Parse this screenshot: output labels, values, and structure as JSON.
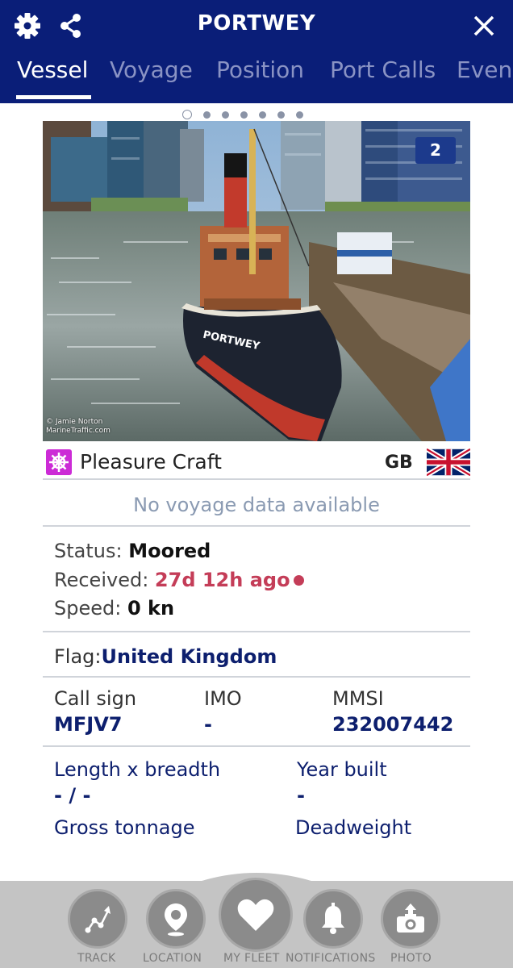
{
  "header": {
    "title": "PORTWEY",
    "tabs": [
      {
        "label": "Vessel",
        "active": true
      },
      {
        "label": "Voyage",
        "active": false
      },
      {
        "label": "Position",
        "active": false
      },
      {
        "label": "Port Calls",
        "active": false
      },
      {
        "label": "Even",
        "active": false
      }
    ]
  },
  "carousel": {
    "dot_count": 7,
    "active_index": 0
  },
  "photo": {
    "count_badge": "2",
    "credit_line1": "© Jamie Norton",
    "credit_line2": "MarineTraffic.com",
    "hull_name": "PORTWEY"
  },
  "vessel_type": {
    "label": "Pleasure Craft",
    "icon": "ship-wheel-icon",
    "icon_color": "#cc2bd6"
  },
  "flag": {
    "code": "GB",
    "country": "United Kingdom"
  },
  "voyage": {
    "message": "No voyage data available"
  },
  "status": {
    "status_label": "Status:",
    "status_value": "Moored",
    "received_label": "Received:",
    "received_value": "27d 12h ago",
    "speed_label": "Speed:",
    "speed_value": "0 kn"
  },
  "flag_row": {
    "label": "Flag:"
  },
  "identifiers": {
    "call_sign_label": "Call sign",
    "call_sign_value": "MFJV7",
    "imo_label": "IMO",
    "imo_value": "-",
    "mmsi_label": "MMSI",
    "mmsi_value": "232007442"
  },
  "dimensions": {
    "length_label": "Length x breadth",
    "length_value": "- / -",
    "year_label": "Year built",
    "year_value": "-",
    "gross_label": "Gross tonnage",
    "deadweight_label": "Deadweight"
  },
  "bottom_nav": [
    {
      "label": "TRACK",
      "icon": "track-icon"
    },
    {
      "label": "LOCATION",
      "icon": "location-pin-icon"
    },
    {
      "label": "MY FLEET",
      "icon": "heart-icon"
    },
    {
      "label": "NOTIFICATIONS",
      "icon": "bell-icon"
    },
    {
      "label": "PHOTO",
      "icon": "camera-upload-icon"
    }
  ],
  "colors": {
    "header": "#0a1e78",
    "accent_navy": "#0d1f6e",
    "alert_red": "#c43d58",
    "nav_bg": "#c4c4c4"
  }
}
